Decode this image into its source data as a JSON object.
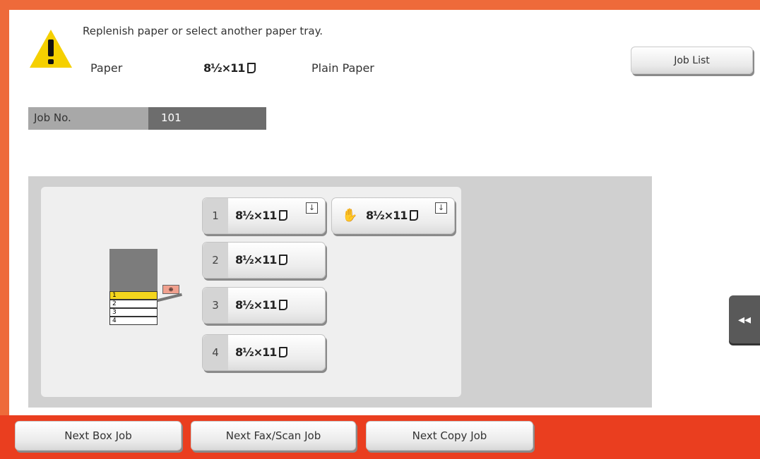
{
  "header": {
    "warning_icon": "warning-triangle-icon",
    "message": "Replenish paper or select another paper tray.",
    "paper_label": "Paper",
    "paper_size": "8½×11",
    "paper_type": "Plain Paper",
    "job_list_label": "Job List"
  },
  "job": {
    "label": "Job No.",
    "value": "101"
  },
  "trays": [
    {
      "num": "1",
      "size": "8½×11",
      "selected": true,
      "load_icon": "load-paper-icon"
    },
    {
      "num": "2",
      "size": "8½×11"
    },
    {
      "num": "3",
      "size": "8½×11"
    },
    {
      "num": "4",
      "size": "8½×11"
    }
  ],
  "bypass_tray": {
    "icon": "hand-icon",
    "size": "8½×11",
    "load_icon": "load-paper-icon"
  },
  "printer_diagram": {
    "rows": [
      "1",
      "2",
      "3",
      "4"
    ],
    "bypass_mark": "⊕"
  },
  "side_tab": {
    "icon": "double-chevron-left-icon",
    "glyph": "◂◂"
  },
  "footer": {
    "next_box": "Next Box Job",
    "next_fax_scan": "Next Fax/Scan Job",
    "next_copy": "Next Copy Job"
  },
  "colors": {
    "frame": "#ee6a3a",
    "footer": "#ea3e1f",
    "selected_tray": "#f3d51d",
    "warning": "#f5d000"
  }
}
